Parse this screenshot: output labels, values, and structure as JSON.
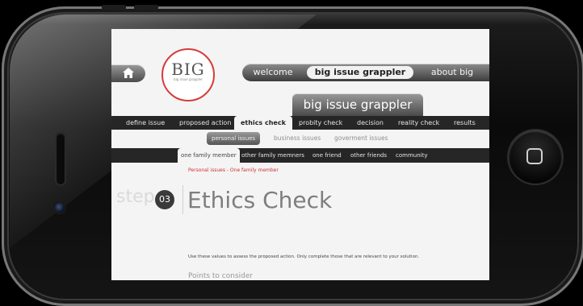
{
  "header": {
    "home_icon": "home-icon",
    "logo_text": "BIG",
    "logo_subtext": "big issue grappler"
  },
  "top_nav": {
    "items": [
      {
        "label": "welcome",
        "active": false
      },
      {
        "label": "big issue grappler",
        "active": true
      },
      {
        "label": "about big",
        "active": false
      }
    ]
  },
  "title_tab": "big issue grappler",
  "process_tabs": [
    {
      "label": "define issue",
      "active": false
    },
    {
      "label": "proposed action",
      "active": false
    },
    {
      "label": "ethics check",
      "active": true
    },
    {
      "label": "probity check",
      "active": false
    },
    {
      "label": "decision",
      "active": false
    },
    {
      "label": "reality check",
      "active": false
    },
    {
      "label": "results",
      "active": false
    }
  ],
  "issue_tabs": [
    {
      "label": "personal issues",
      "active": true
    },
    {
      "label": "business issues",
      "active": false
    },
    {
      "label": "goverment issues",
      "active": false
    }
  ],
  "relation_tabs": [
    {
      "label": "one family member",
      "active": true
    },
    {
      "label": "other family memners",
      "active": false
    },
    {
      "label": "one friend",
      "active": false
    },
    {
      "label": "other friends",
      "active": false
    },
    {
      "label": "community",
      "active": false
    }
  ],
  "breadcrumb": "Personal issues - One family member",
  "step": {
    "label": "step",
    "number": "03",
    "heading": "Ethics Check"
  },
  "instructions": "Use these values to assess the proposed action. Only complete those that are relevant to your solution.",
  "points_heading": "Points to consider",
  "colors": {
    "accent_red": "#d73b3b",
    "nav_dark": "#262626",
    "screen_bg": "#f4f4f4"
  }
}
